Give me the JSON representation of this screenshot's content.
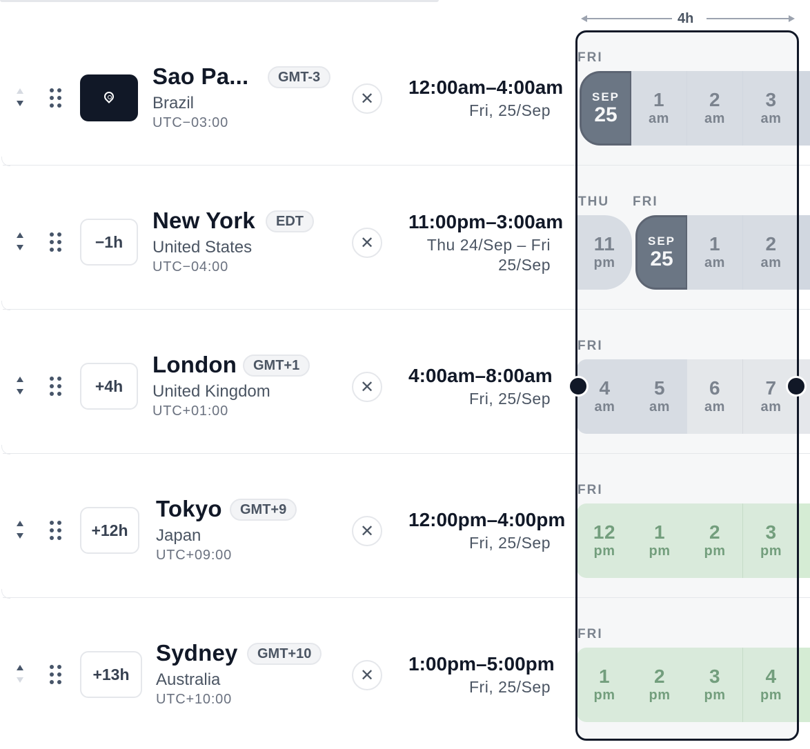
{
  "scale": {
    "label": "4h"
  },
  "rows": [
    {
      "offset": "",
      "city": "Sao Pa...",
      "tz": "GMT-3",
      "country": "Brazil",
      "utc": "UTC−03:00",
      "range": "12:00am–4:00am",
      "date_lines": [
        "Fri, 25/Sep"
      ],
      "day_labels": [
        "FRI"
      ],
      "cells": [
        {
          "mon": "SEP",
          "day": "25"
        },
        {
          "h": "1",
          "m": "am"
        },
        {
          "h": "2",
          "m": "am"
        },
        {
          "h": "3",
          "m": "am"
        }
      ]
    },
    {
      "offset": "−1h",
      "city": "New York",
      "tz": "EDT",
      "country": "United States",
      "utc": "UTC−04:00",
      "range": "11:00pm–3:00am",
      "date_lines": [
        "Thu 24/Sep – Fri",
        "25/Sep"
      ],
      "day_labels": [
        "THU",
        "FRI"
      ],
      "cells": [
        {
          "h": "11",
          "m": "pm"
        },
        {
          "mon": "SEP",
          "day": "25"
        },
        {
          "h": "1",
          "m": "am"
        },
        {
          "h": "2",
          "m": "am"
        }
      ]
    },
    {
      "offset": "+4h",
      "city": "London",
      "tz": "GMT+1",
      "country": "United Kingdom",
      "utc": "UTC+01:00",
      "range": "4:00am–8:00am",
      "date_lines": [
        "Fri, 25/Sep"
      ],
      "day_labels": [
        "FRI"
      ],
      "cells": [
        {
          "h": "4",
          "m": "am"
        },
        {
          "h": "5",
          "m": "am"
        },
        {
          "h": "6",
          "m": "am"
        },
        {
          "h": "7",
          "m": "am"
        }
      ]
    },
    {
      "offset": "+12h",
      "city": "Tokyo",
      "tz": "GMT+9",
      "country": "Japan",
      "utc": "UTC+09:00",
      "range": "12:00pm–4:00pm",
      "date_lines": [
        "Fri, 25/Sep"
      ],
      "day_labels": [
        "FRI"
      ],
      "cells": [
        {
          "h": "12",
          "m": "pm"
        },
        {
          "h": "1",
          "m": "pm"
        },
        {
          "h": "2",
          "m": "pm"
        },
        {
          "h": "3",
          "m": "pm"
        }
      ]
    },
    {
      "offset": "+13h",
      "city": "Sydney",
      "tz": "GMT+10",
      "country": "Australia",
      "utc": "UTC+10:00",
      "range": "1:00pm–5:00pm",
      "date_lines": [
        "Fri, 25/Sep"
      ],
      "day_labels": [
        "FRI"
      ],
      "cells": [
        {
          "h": "1",
          "m": "pm"
        },
        {
          "h": "2",
          "m": "pm"
        },
        {
          "h": "3",
          "m": "pm"
        },
        {
          "h": "4",
          "m": "pm"
        }
      ]
    }
  ],
  "colors": {
    "dark": "#111827",
    "home_cell": "#334155",
    "night_cell": "#d1d7e0",
    "day_cell": "#e5e7eb",
    "work_cell": "#d5ecd4"
  }
}
